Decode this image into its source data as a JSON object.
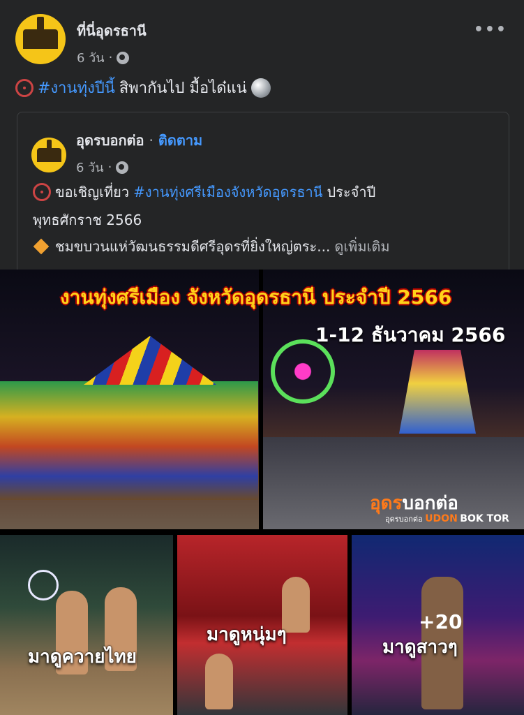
{
  "post": {
    "page_name": "ที่นี่อุดรธานี",
    "time": "6 วัน",
    "text_hashtag": "#งานทุ่งปีนี้",
    "text_body": "สิพากันไป มื้อได๋แน่"
  },
  "shared": {
    "page_name": "อุดรบอกต่อ",
    "separator": "·",
    "follow_label": "ติดตาม",
    "time": "6 วัน",
    "line1_prefix": "ขอเชิญเที่ยว",
    "line1_hashtag": "#งานทุ่งศรีเมืองจังหวัดอุดรธานี",
    "line1_suffix": "ประจำปี",
    "line2": "พุทธศักราช 2566",
    "line3": "ชมขบวนแห่วัฒนธรรมดีศรีอุดรที่ยิ่งใหญ่ตระ...",
    "see_more": "ดูเพิ่มเติม"
  },
  "media": {
    "banner_title": "งานทุ่งศรีเมือง จังหวัดอุดรธานี ประจำปี 2566",
    "banner_date": "1-12 ธันวาคม 2566",
    "brand_thai_a": "อุดร",
    "brand_thai_b": "บอกต่อ",
    "brand_sub_a": "อุดรบอกต่อ",
    "brand_sub_b": "UDON",
    "brand_sub_c": "BOK TOR",
    "thumb1_label": "มาดูควายไทย",
    "thumb2_label": "มาดูหนุ่มๆ",
    "thumb3_label": "มาดูสาวๆ",
    "more_count": "+20"
  },
  "icons": [
    "ferris-wheel-icon",
    "disco-ball-icon",
    "globe-icon",
    "more-icon",
    "diamond-icon"
  ]
}
